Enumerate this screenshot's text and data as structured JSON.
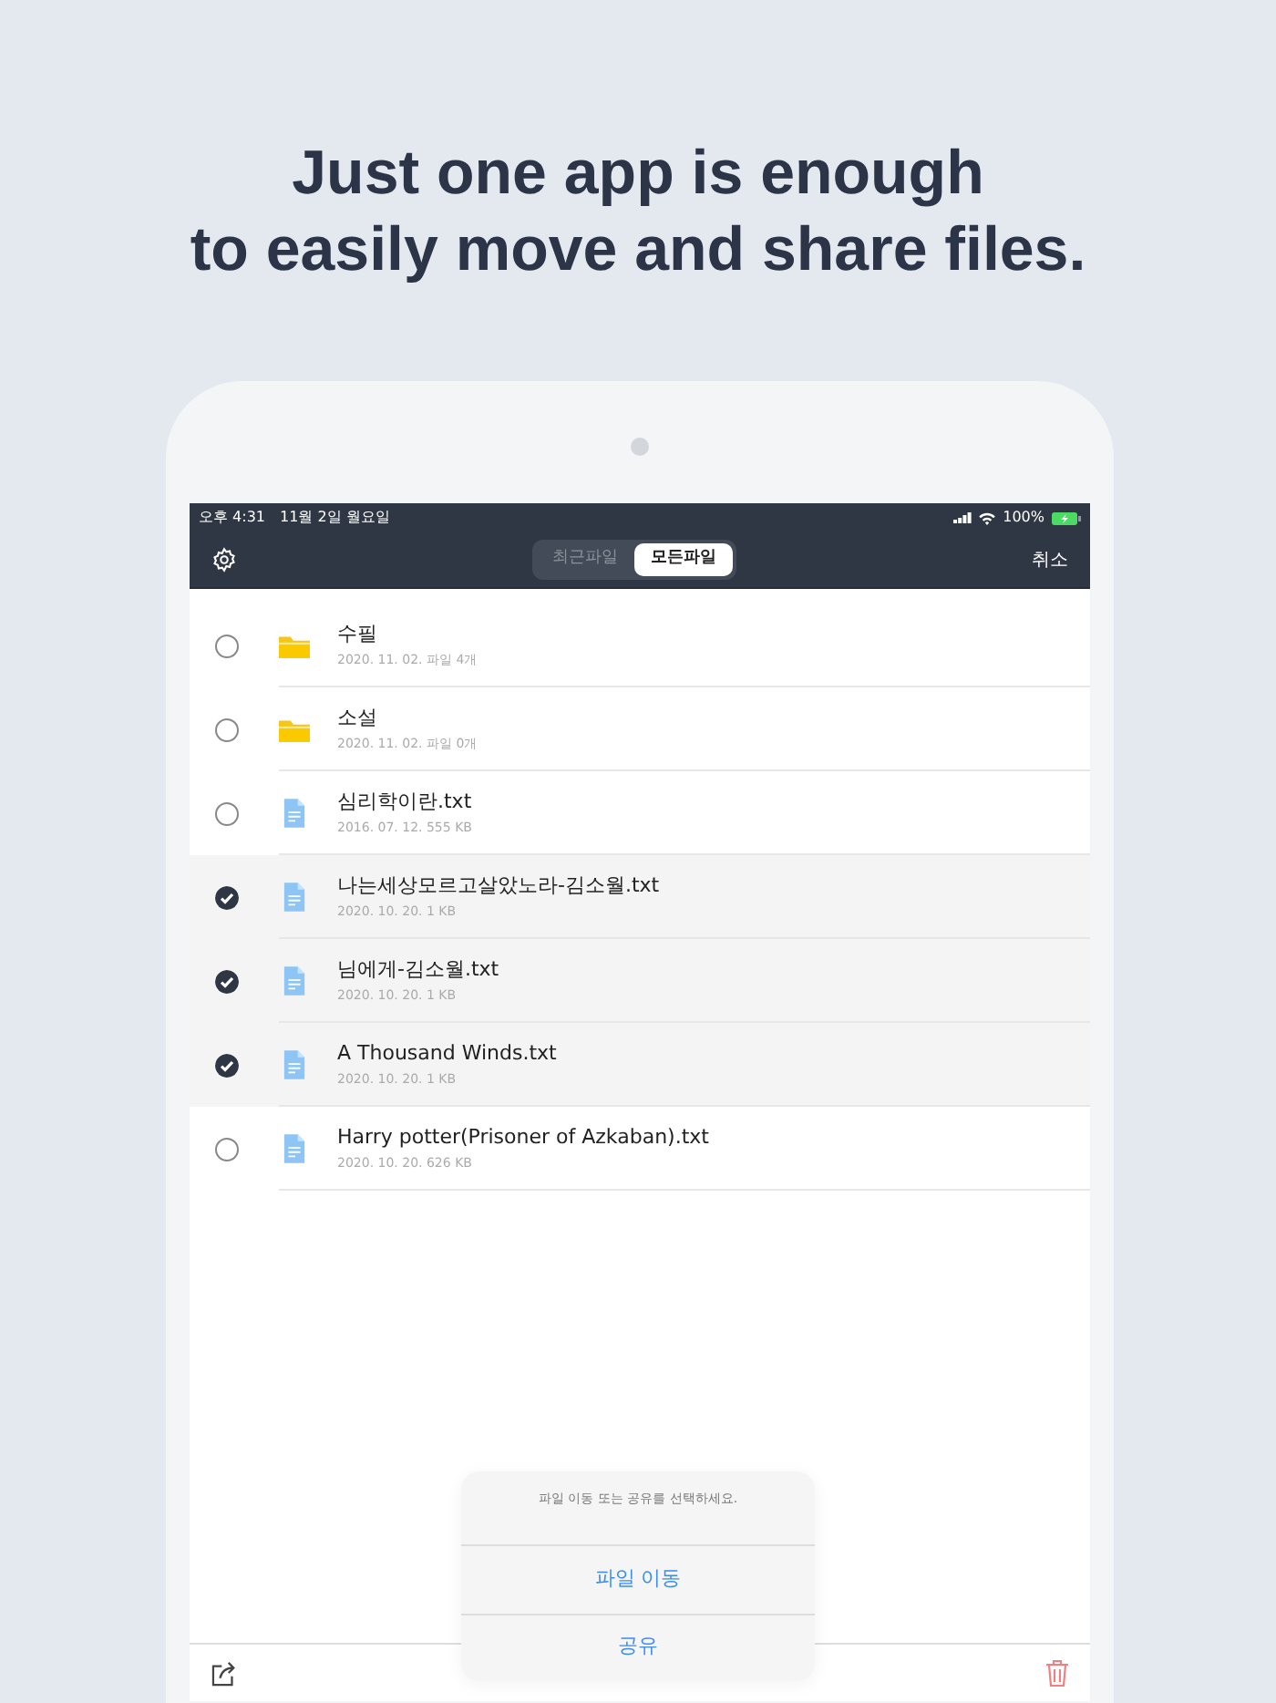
{
  "headline": [
    "Just one app is enough",
    "to easily move and share files."
  ],
  "status_bar": {
    "time": "오후 4:31",
    "date": "11월 2일 월요일",
    "battery": "100%"
  },
  "nav": {
    "tabs": [
      {
        "label": "최근파일",
        "selected": false
      },
      {
        "label": "모든파일",
        "selected": true
      }
    ],
    "cancel": "취소"
  },
  "files": [
    {
      "kind": "folder",
      "name": "수필",
      "meta": "2020. 11. 02. 파일 4개",
      "selected": false
    },
    {
      "kind": "folder",
      "name": "소설",
      "meta": "2020. 11. 02. 파일 0개",
      "selected": false
    },
    {
      "kind": "file",
      "name": "심리학이란.txt",
      "meta": "2016. 07. 12. 555 KB",
      "selected": false
    },
    {
      "kind": "file",
      "name": "나는세상모르고살았노라-김소월.txt",
      "meta": "2020. 10. 20. 1 KB",
      "selected": true
    },
    {
      "kind": "file",
      "name": "님에게-김소월.txt",
      "meta": "2020. 10. 20. 1 KB",
      "selected": true
    },
    {
      "kind": "file",
      "name": "A Thousand Winds.txt",
      "meta": "2020. 10. 20. 1 KB",
      "selected": true
    },
    {
      "kind": "file",
      "name": "Harry potter(Prisoner of Azkaban).txt",
      "meta": "2020. 10. 20. 626 KB",
      "selected": false
    }
  ],
  "action_sheet": {
    "message": "파일 이동 또는 공유를 선택하세요.",
    "actions": [
      "파일 이동",
      "공유"
    ]
  }
}
